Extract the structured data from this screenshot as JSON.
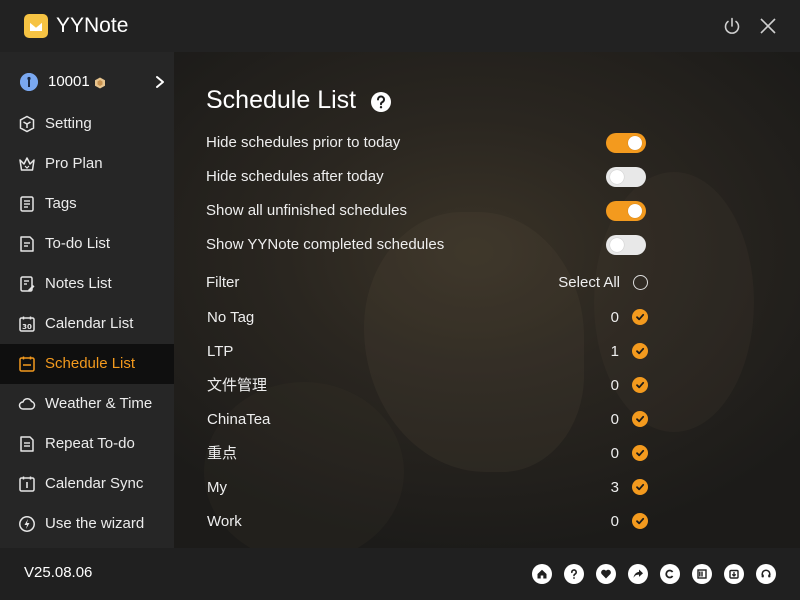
{
  "app": {
    "title": "YYNote"
  },
  "user": {
    "id": "10001"
  },
  "sidebar": {
    "items": [
      {
        "label": "Setting",
        "icon": "settings-hex-icon"
      },
      {
        "label": "Pro Plan",
        "icon": "crown-icon"
      },
      {
        "label": "Tags",
        "icon": "tag-list-icon"
      },
      {
        "label": "To-do List",
        "icon": "todo-icon"
      },
      {
        "label": "Notes List",
        "icon": "notes-icon"
      },
      {
        "label": "Calendar List",
        "icon": "calendar-30-icon"
      },
      {
        "label": "Schedule List",
        "icon": "schedule-icon",
        "active": true
      },
      {
        "label": "Weather & Time",
        "icon": "cloud-icon"
      },
      {
        "label": "Repeat To-do",
        "icon": "repeat-icon"
      },
      {
        "label": "Calendar Sync",
        "icon": "calendar-sync-icon"
      },
      {
        "label": "Use the wizard",
        "icon": "lightning-icon"
      }
    ]
  },
  "main": {
    "title": "Schedule List",
    "toggles": [
      {
        "label": "Hide schedules prior to today",
        "on": true
      },
      {
        "label": "Hide schedules after today",
        "on": false
      },
      {
        "label": "Show all unfinished schedules",
        "on": true
      },
      {
        "label": "Show YYNote completed schedules",
        "on": false
      }
    ],
    "filter": {
      "label": "Filter",
      "select_all": "Select All"
    },
    "tags": [
      {
        "name": "No Tag",
        "count": "0",
        "checked": true
      },
      {
        "name": "LTP",
        "count": "1",
        "checked": true
      },
      {
        "name": "文件管理",
        "count": "0",
        "checked": true
      },
      {
        "name": "ChinaTea",
        "count": "0",
        "checked": true
      },
      {
        "name": "重点",
        "count": "0",
        "checked": true
      },
      {
        "name": "My",
        "count": "3",
        "checked": true
      },
      {
        "name": "Work",
        "count": "0",
        "checked": true
      }
    ]
  },
  "footer": {
    "version": "V25.08.06",
    "icons": [
      "home-icon",
      "help-icon",
      "heart-icon",
      "share-icon",
      "copyright-icon",
      "export-icon",
      "download-icon",
      "support-icon"
    ]
  },
  "colors": {
    "accent": "#f39a1e",
    "sidebar_bg": "#262626",
    "active_bg": "#0f0f0f",
    "titlebar_bg": "#222222"
  }
}
